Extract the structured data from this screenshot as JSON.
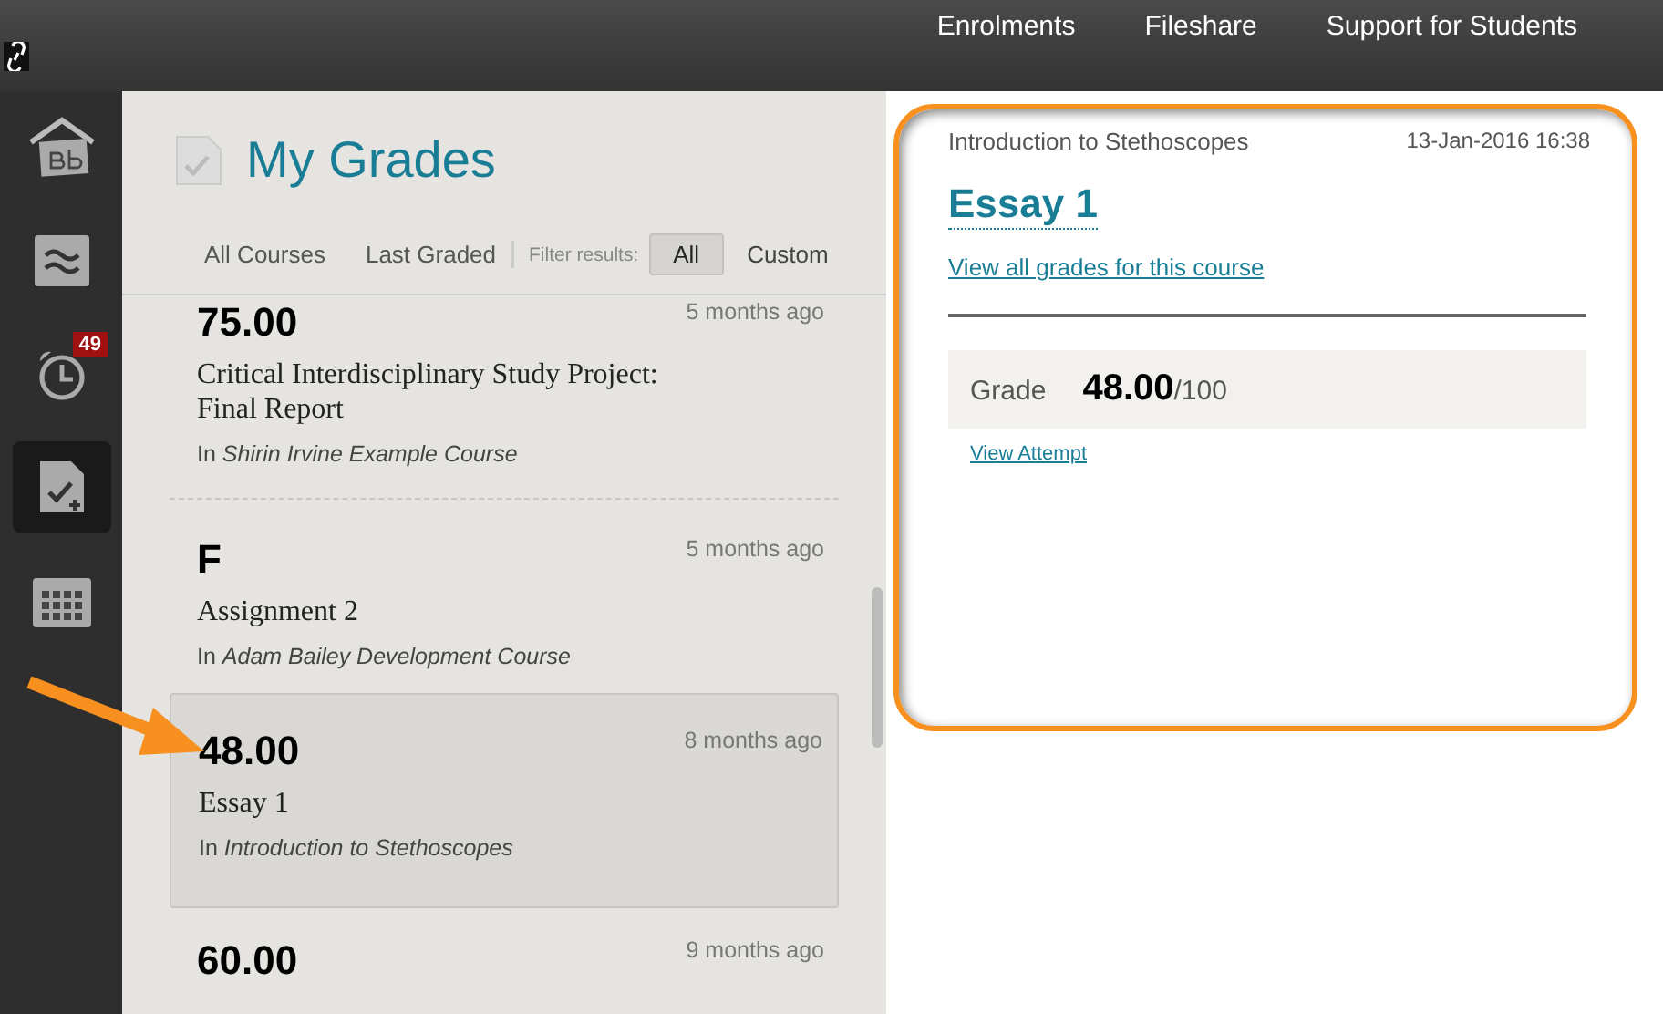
{
  "top_nav": [
    {
      "label": "Enrolments"
    },
    {
      "label": "Fileshare"
    },
    {
      "label": "Support for Students"
    }
  ],
  "sidebar": {
    "items": [
      {
        "kind": "home",
        "selected": false
      },
      {
        "kind": "stream",
        "selected": false
      },
      {
        "kind": "due",
        "selected": false,
        "badge": "49"
      },
      {
        "kind": "grades",
        "selected": true
      },
      {
        "kind": "calendar",
        "selected": false
      }
    ]
  },
  "header": {
    "title": "My Grades"
  },
  "sort_options": [
    {
      "label": "All Courses"
    },
    {
      "label": "Last Graded"
    }
  ],
  "filter": {
    "label": "Filter results:",
    "options": [
      {
        "label": "All",
        "selected": true
      },
      {
        "label": "Custom",
        "selected": false
      }
    ]
  },
  "grades": [
    {
      "grade": "75.00",
      "title": "Critical Interdisciplinary Study Project: Final Report",
      "course_prefix": "In",
      "course": "Shirin Irvine Example Course",
      "time": "5 months ago",
      "selected": false
    },
    {
      "grade": "F",
      "title": "Assignment 2",
      "course_prefix": "In",
      "course": "Adam Bailey Development Course",
      "time": "5 months ago",
      "selected": false
    },
    {
      "grade": "48.00",
      "title": "Essay 1",
      "course_prefix": "In",
      "course": "Introduction to Stethoscopes",
      "time": "8 months ago",
      "selected": true
    },
    {
      "grade": "60.00",
      "time": "9 months ago",
      "selected": false
    }
  ],
  "detail": {
    "course": "Introduction to Stethoscopes",
    "date": "13-Jan-2016 16:38",
    "title": "Essay 1",
    "course_link": "View all grades for this course",
    "grade_label": "Grade",
    "grade_value": "48.00",
    "grade_max": "/100",
    "attempt_link": "View Attempt"
  }
}
